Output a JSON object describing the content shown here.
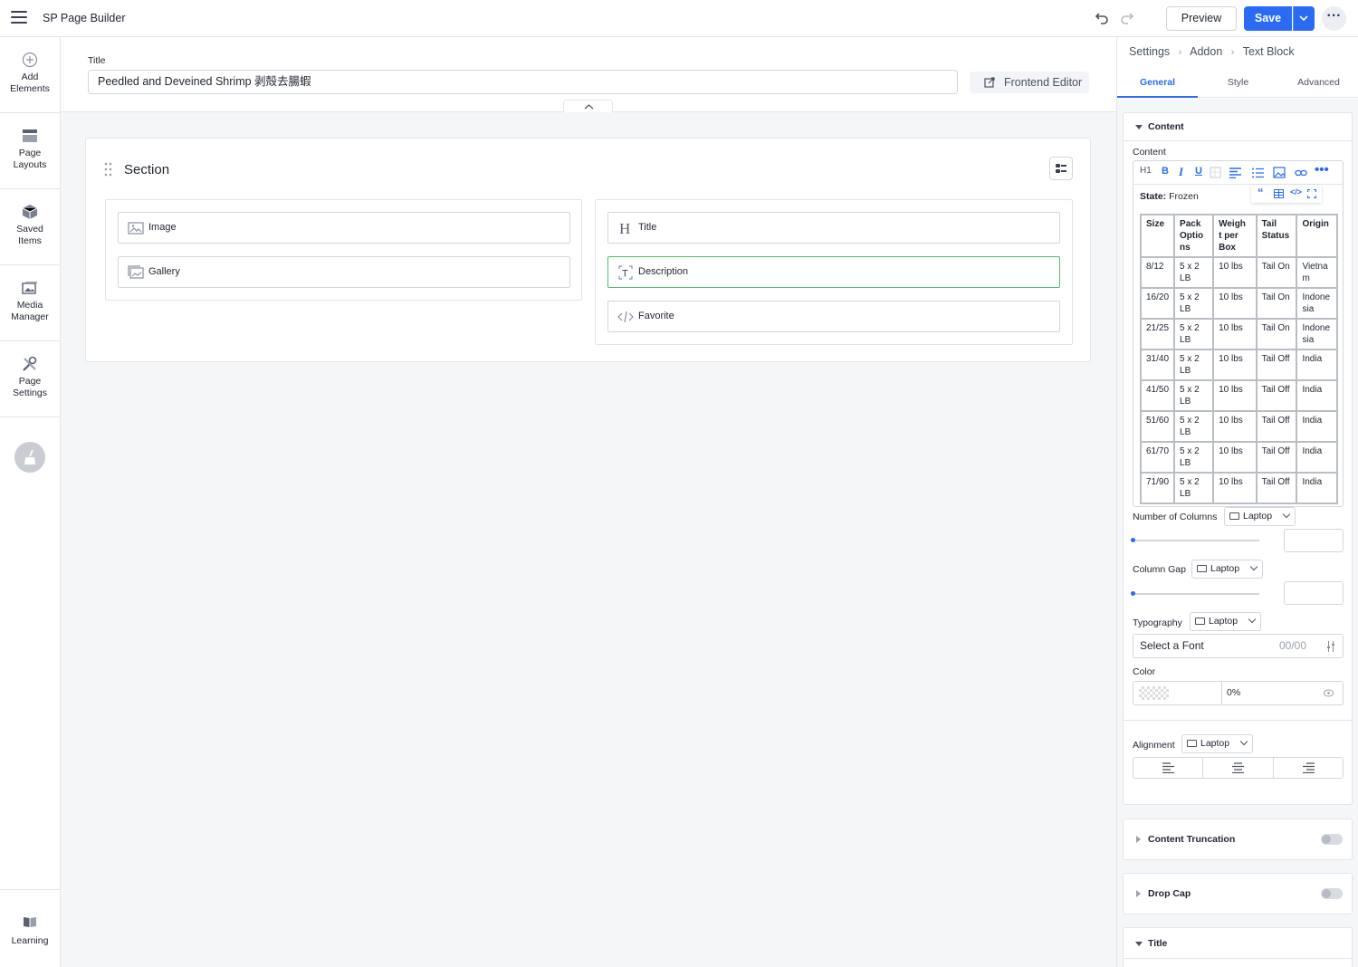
{
  "app": {
    "title": "SP Page Builder"
  },
  "header": {
    "preview_label": "Preview",
    "save_label": "Save"
  },
  "sidebar": {
    "items": [
      {
        "line1": "Add",
        "line2": "Elements",
        "icon": "plus-circle-icon"
      },
      {
        "line1": "Page",
        "line2": "Layouts",
        "icon": "layout-icon"
      },
      {
        "line1": "Saved",
        "line2": "Items",
        "icon": "box-icon"
      },
      {
        "line1": "Media",
        "line2": "Manager",
        "icon": "media-icon"
      },
      {
        "line1": "Page",
        "line2": "Settings",
        "icon": "tools-icon"
      }
    ],
    "learning": "Learning"
  },
  "page": {
    "title_label": "Title",
    "title_value": "Peedled and Deveined Shrimp 剥殻去腸蝦",
    "frontend_editor": "Frontend Editor"
  },
  "section": {
    "title": "Section",
    "columns": [
      {
        "addons": [
          {
            "label": "Image",
            "icon": "image-icon"
          },
          {
            "label": "Gallery",
            "icon": "gallery-icon"
          }
        ]
      },
      {
        "addons": [
          {
            "label": "Title",
            "icon": "heading-icon"
          },
          {
            "label": "Description",
            "icon": "text-icon",
            "active": true
          },
          {
            "label": "Favorite",
            "icon": "code-icon"
          }
        ]
      }
    ]
  },
  "panel": {
    "breadcrumb": [
      "Settings",
      "Addon",
      "Text Block"
    ],
    "tabs": [
      "General",
      "Style",
      "Advanced"
    ],
    "active_tab": "General",
    "content_section": "Content",
    "content_label": "Content",
    "toolbar_h1": "H1",
    "state_label": "State:",
    "state_value": "Frozen",
    "table": {
      "headers": [
        "Size",
        "Pack Optio ns",
        "Weigh t per Box",
        "Tail Status",
        "Origin"
      ],
      "rows": [
        [
          "8/12",
          "5 x 2 LB",
          "10 lbs",
          "Tail On",
          "Vietna m"
        ],
        [
          "16/20",
          "5 x 2 LB",
          "10 lbs",
          "Tail On",
          "Indone sia"
        ],
        [
          "21/25",
          "5 x 2 LB",
          "10 lbs",
          "Tail On",
          "Indone sia"
        ],
        [
          "31/40",
          "5 x 2 LB",
          "10 lbs",
          "Tail Off",
          "India"
        ],
        [
          "41/50",
          "5 x 2 LB",
          "10 lbs",
          "Tail Off",
          "India"
        ],
        [
          "51/60",
          "5 x 2 LB",
          "10 lbs",
          "Tail Off",
          "India"
        ],
        [
          "61/70",
          "5 x 2 LB",
          "10 lbs",
          "Tail Off",
          "India"
        ],
        [
          "71/90",
          "5 x 2 LB",
          "10 lbs",
          "Tail Off",
          "India"
        ]
      ]
    },
    "number_of_columns": "Number of Columns",
    "column_gap": "Column Gap",
    "typography": "Typography",
    "device": "Laptop",
    "font_placeholder": "Select a Font",
    "font_size": "00/00",
    "color_label": "Color",
    "opacity": "0%",
    "alignment_label": "Alignment",
    "content_truncation": "Content Truncation",
    "drop_cap": "Drop Cap",
    "title_section": "Title"
  },
  "colors": {
    "accent": "#2a6bf2",
    "active_addon_border": "#4bbf6b"
  }
}
